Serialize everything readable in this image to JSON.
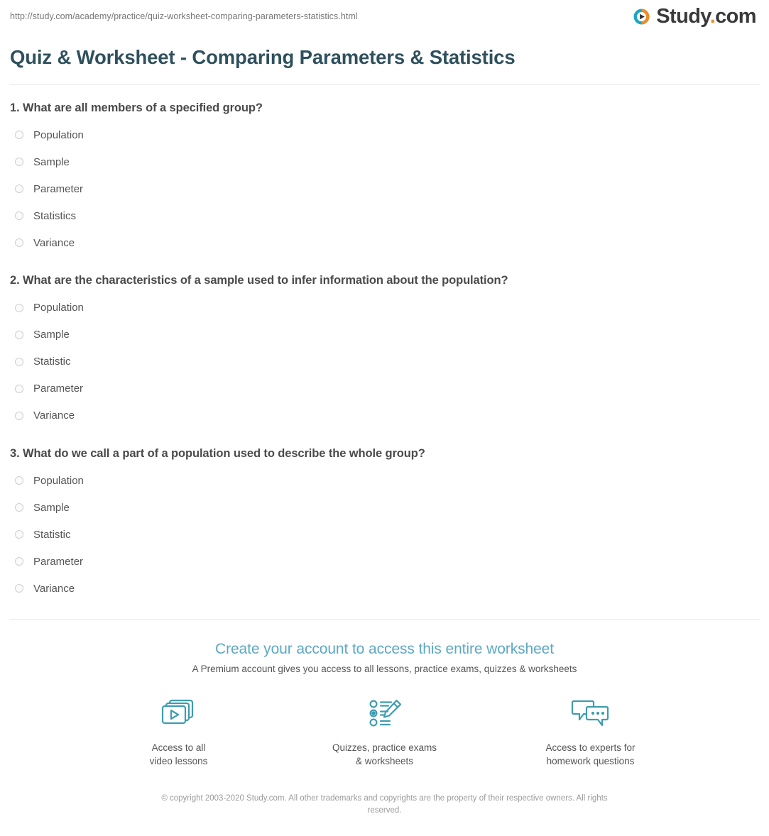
{
  "header": {
    "url": "http://study.com/academy/practice/quiz-worksheet-comparing-parameters-statistics.html",
    "logo": {
      "name": "Study",
      "dot": ".",
      "tld": "com",
      "icon": "play-circle-icon",
      "colors": {
        "teal": "#1ba7c4",
        "orange": "#f08a24",
        "text": "#3a3a3a"
      }
    }
  },
  "page_title": "Quiz & Worksheet - Comparing Parameters & Statistics",
  "questions": [
    {
      "number": "1.",
      "text": "1. What are all members of a specified group?",
      "options": [
        "Population",
        "Sample",
        "Parameter",
        "Statistics",
        "Variance"
      ]
    },
    {
      "number": "2.",
      "text": "2. What are the characteristics of a sample used to infer information about the population?",
      "options": [
        "Population",
        "Sample",
        "Statistic",
        "Parameter",
        "Variance"
      ]
    },
    {
      "number": "3.",
      "text": "3. What do we call a part of a population used to describe the whole group?",
      "options": [
        "Population",
        "Sample",
        "Statistic",
        "Parameter",
        "Variance"
      ]
    }
  ],
  "cta": {
    "title": "Create your account to access this entire worksheet",
    "subtitle": "A Premium account gives you access to all lessons, practice exams, quizzes & worksheets",
    "title_color": "#5da8c4",
    "features": [
      {
        "icon": "video-lessons-icon",
        "label": "Access to all\nvideo lessons"
      },
      {
        "icon": "quiz-pencil-icon",
        "label": "Quizzes, practice exams\n& worksheets"
      },
      {
        "icon": "chat-bubbles-icon",
        "label": "Access to experts for\nhomework questions"
      }
    ],
    "icon_color": "#3e9cb0"
  },
  "copyright": "© copyright 2003-2020 Study.com. All other trademarks and copyrights are the property of their respective owners. All rights reserved."
}
